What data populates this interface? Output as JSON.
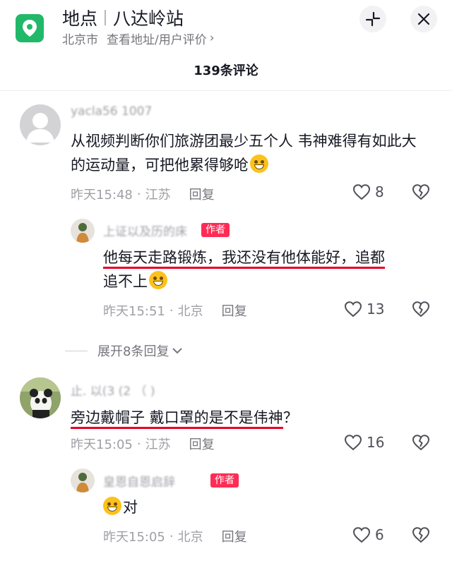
{
  "header": {
    "title": "地点",
    "station": "八达岭站",
    "city": "北京市",
    "subtitle": "查看地址/用户评价",
    "location_icon": "map-pin-icon",
    "minimize_icon": "collapse-icon",
    "close_icon": "close-icon"
  },
  "comments_title": "139条评论",
  "comments": [
    {
      "user": "yacla56 1007",
      "text_parts": [
        "从视频判断你们旅游团最少五个人  韦神难得有如此大的运动量，可把他累得够呛"
      ],
      "time": "昨天15:48",
      "location": "江苏",
      "reply": "回复",
      "likes": "8"
    },
    {
      "user": "上证以及历的床",
      "tag": "作者",
      "text_parts": [
        "他每天走路锻炼，我还没有他体能好，追都",
        "追不上"
      ],
      "time": "昨天15:51",
      "location": "北京",
      "reply": "回复",
      "likes": "13"
    },
    {
      "expand": "展开8条回复"
    },
    {
      "user": "止. 以(3  (2 （ )",
      "text_parts": [
        "旁边戴帽子 戴口罩的是不是伟神",
        "？"
      ],
      "time": "昨天15:05",
      "location": "江苏",
      "reply": "回复",
      "likes": "16"
    },
    {
      "user": "皇恩自恩启辞",
      "tag": "作者",
      "text_parts": [
        "对"
      ],
      "time": "昨天15:05",
      "location": "北京",
      "reply": "回复",
      "likes": "6"
    }
  ],
  "colors": {
    "accent": "#fe2c55",
    "location_green": "#22b869",
    "underline_red": "#e60023"
  }
}
